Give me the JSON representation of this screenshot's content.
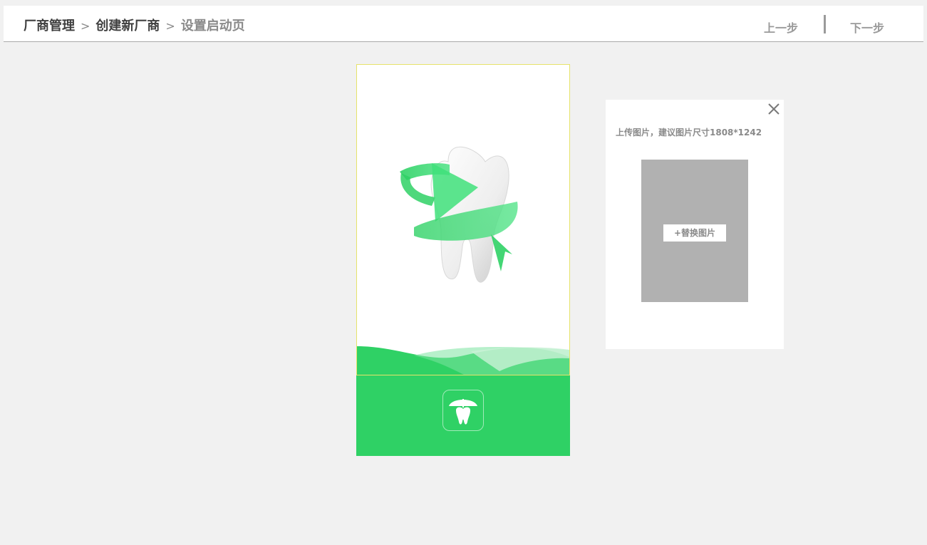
{
  "header": {
    "breadcrumb": [
      {
        "label": "厂商管理"
      },
      {
        "label": "创建新厂商"
      },
      {
        "label": "设置启动页"
      }
    ],
    "separator": ">",
    "prev_label": "上一步",
    "next_label": "下一步"
  },
  "preview": {
    "splash_image_icon": "tooth-play-icon",
    "app_icon": "tooth-umbrella-icon",
    "accent_color": "#2fd165"
  },
  "upload_panel": {
    "hint": "上传图片，建议图片尺寸1808*1242",
    "replace_label": "+替换图片",
    "close_icon": "close-icon"
  }
}
